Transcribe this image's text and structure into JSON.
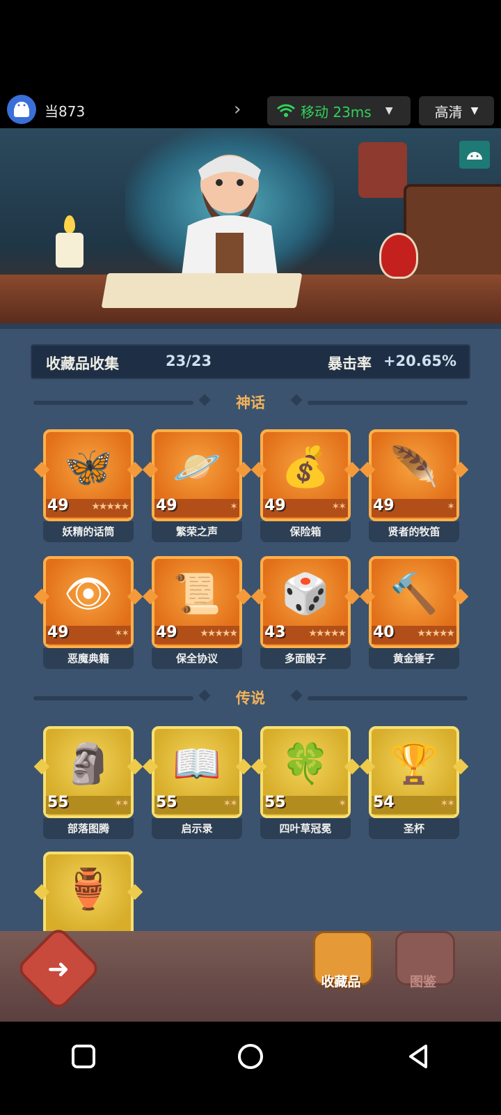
{
  "topbar": {
    "username": "当873",
    "network": "移动 23ms",
    "quality": "高清"
  },
  "progress": {
    "label": "收藏品收集",
    "value": "23/23",
    "crit_label": "暴击率",
    "crit_value": "+20.65%"
  },
  "sections": {
    "myth": {
      "title": "神话"
    },
    "legend": {
      "title": "传说"
    }
  },
  "myth_items": [
    {
      "level": "49",
      "stars": "★★★★★",
      "name": "妖精的话筒",
      "icon": "🦋"
    },
    {
      "level": "49",
      "stars": "✶",
      "name": "繁荣之声",
      "icon": "🪐"
    },
    {
      "level": "49",
      "stars": "✶✶",
      "name": "保险箱",
      "icon": "💰"
    },
    {
      "level": "49",
      "stars": "✶",
      "name": "贤者的牧笛",
      "icon": "🪶"
    },
    {
      "level": "49",
      "stars": "✶✶",
      "name": "恶魔典籍",
      "icon": "👁"
    },
    {
      "level": "49",
      "stars": "★★★★★",
      "name": "保全协议",
      "icon": "📜"
    },
    {
      "level": "43",
      "stars": "★★★★★",
      "name": "多面骰子",
      "icon": "🎲"
    },
    {
      "level": "40",
      "stars": "★★★★★",
      "name": "黄金锤子",
      "icon": "🔨"
    }
  ],
  "legend_items": [
    {
      "level": "55",
      "stars": "✶✶",
      "name": "部落图腾",
      "icon": "🗿"
    },
    {
      "level": "55",
      "stars": "✶✶",
      "name": "启示录",
      "icon": "📖"
    },
    {
      "level": "55",
      "stars": "✶",
      "name": "四叶草冠冕",
      "icon": "🍀"
    },
    {
      "level": "54",
      "stars": "✶✶",
      "name": "圣杯",
      "icon": "🏆"
    },
    {
      "icon": "🏺"
    }
  ],
  "bottomnav": {
    "back_icon": "back-arrow-icon",
    "tab_collectibles": "收藏品",
    "tab_codex": "图鉴"
  },
  "colors": {
    "panel_bg": "#3b536e",
    "myth_orange": "#e26f19",
    "legend_gold": "#d7ad2a",
    "section_title": "#f4b25a",
    "network_green": "#2fd35c"
  }
}
